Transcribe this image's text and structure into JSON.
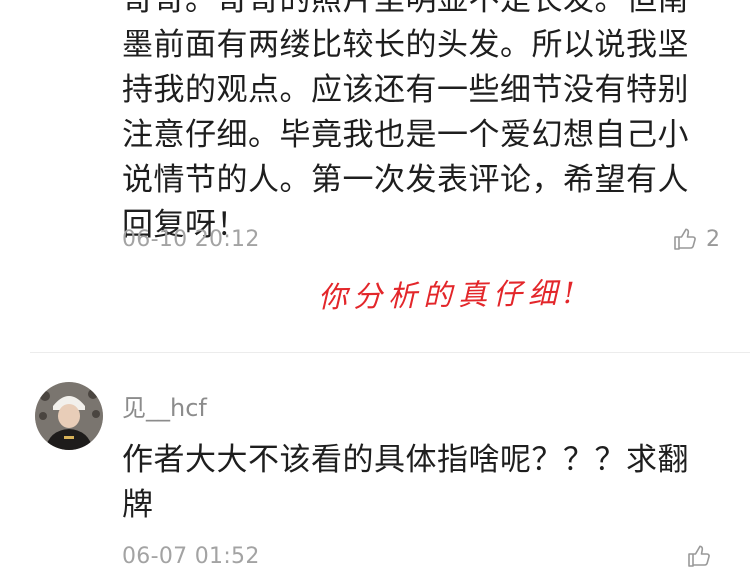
{
  "comment1": {
    "clipped_line": "哥哥。哥哥的照片里明显不是长发。但南",
    "lines": [
      "墨前面有两缕比较长的头发。所以说我坚",
      "持我的观点。应该还有一些细节没有特别",
      "注意仔细。毕竟我也是一个爱幻想自己小",
      "说情节的人。第一次发表评论，希望有人",
      "回复呀！"
    ],
    "timestamp": "06-10 20:12",
    "like_count": "2"
  },
  "annotation": "你分析的真仔细!",
  "comment2": {
    "username": "见__hcf",
    "lines": [
      "作者大大不该看的具体指啥呢？？？求翻",
      "牌"
    ],
    "timestamp": "06-07 01:52",
    "like_count": ""
  },
  "colors": {
    "annotation": "#e3262a",
    "timestamp": "#a3a3a3",
    "text": "#1e1e1e"
  },
  "icons": {
    "like": "thumbs-up-outline-icon"
  }
}
